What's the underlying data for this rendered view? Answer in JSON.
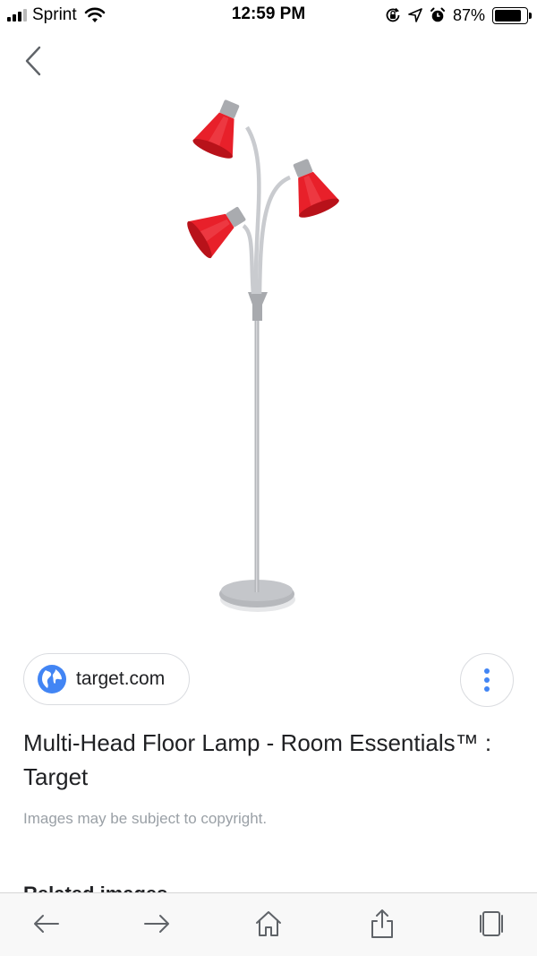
{
  "status_bar": {
    "carrier": "Sprint",
    "time": "12:59 PM",
    "battery_percent": "87%",
    "battery_level": 0.87,
    "icons": [
      "signal-icon",
      "wifi-icon",
      "rotation-lock-icon",
      "location-icon",
      "alarm-icon",
      "battery-icon"
    ]
  },
  "nav": {
    "back_icon": "chevron-left-icon"
  },
  "image": {
    "subject": "lamp-image"
  },
  "source": {
    "label": "target.com",
    "icon": "globe-icon"
  },
  "more_menu": {
    "icon": "more-vert-icon"
  },
  "result": {
    "title": "Multi-Head Floor Lamp - Room Essentials™ : Target",
    "copyright_notice": "Images may be subject to copyright.",
    "related_heading": "Related images"
  },
  "toolbar": {
    "buttons": [
      "back-arrow-icon",
      "forward-arrow-icon",
      "home-icon",
      "share-icon",
      "tabs-icon"
    ]
  },
  "colors": {
    "accent": "#4285f4",
    "lamp_shade": "#e8202a",
    "lamp_metal": "#b5b7bb"
  }
}
